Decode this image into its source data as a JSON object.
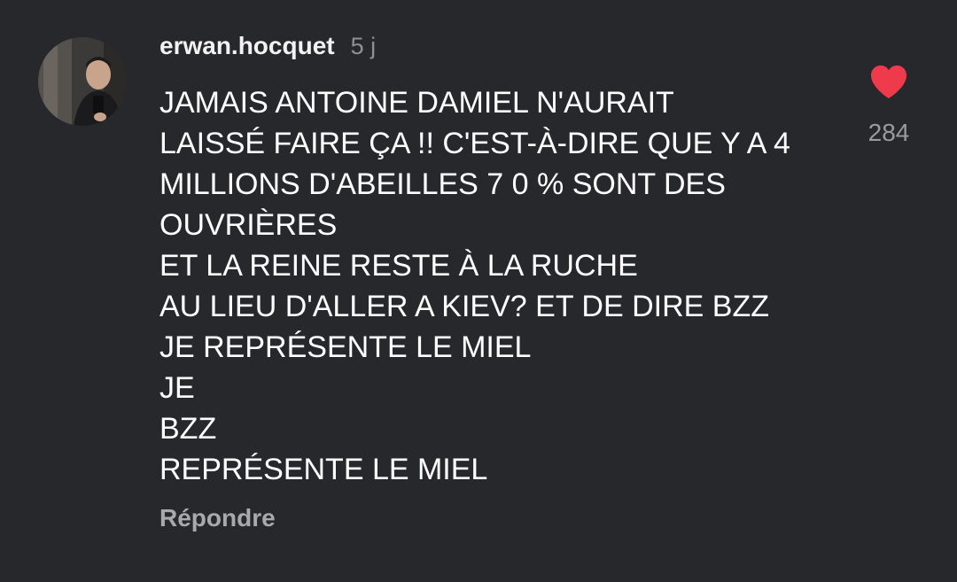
{
  "comment": {
    "username": "erwan.hocquet",
    "timestamp": "5 j",
    "lines": [
      "JAMAIS ANTOINE DAMIEL N'AURAIT",
      "LAISSÉ FAIRE ÇA !! C'EST-À-DIRE QUE Y A 4",
      "MILLIONS D'ABEILLES 7 0 % SONT DES",
      "OUVRIÈRES",
      "ET LA REINE RESTE À LA RUCHE",
      "AU LIEU D'ALLER A KIEV? ET DE DIRE BZZ",
      "JE REPRÉSENTE LE MIEL",
      "JE",
      "BZZ",
      "REPRÉSENTE LE MIEL"
    ],
    "reply_label": "Répondre",
    "like_count": "284",
    "like_icon": "heart-filled-icon",
    "liked": true
  },
  "colors": {
    "background": "#27282c",
    "heart": "#ee3a4a",
    "text": "#ffffff",
    "muted": "#8e9097"
  }
}
